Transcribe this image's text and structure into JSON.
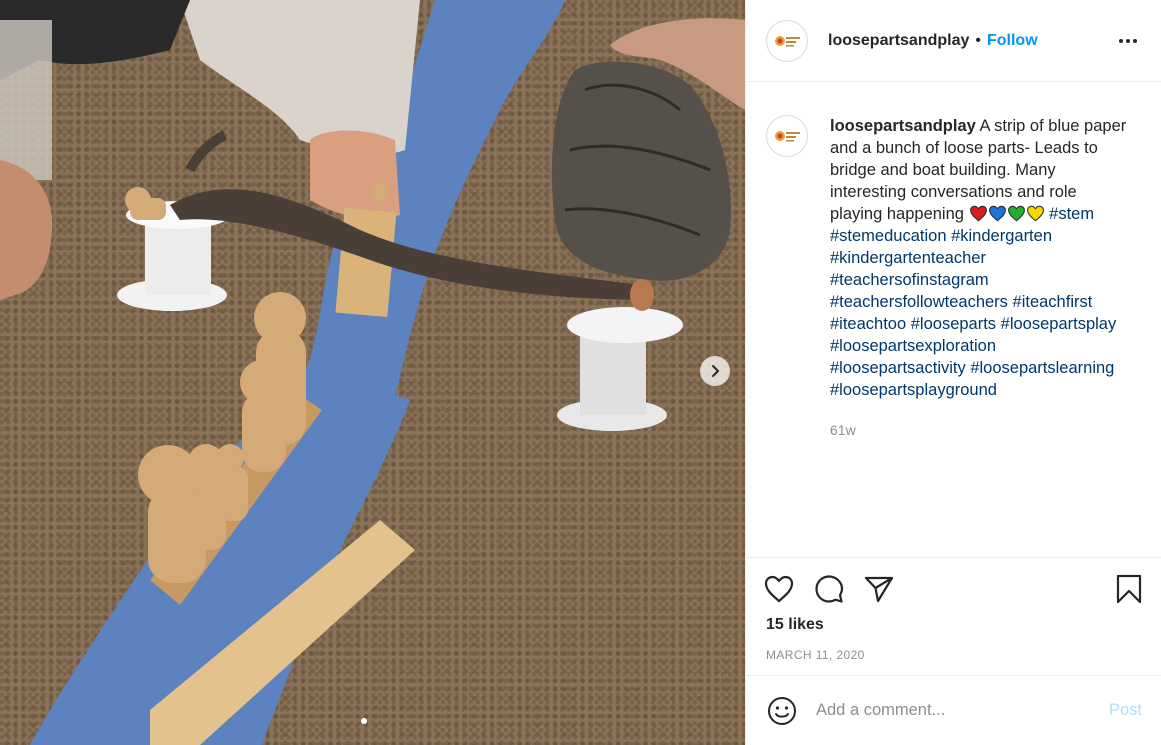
{
  "post": {
    "username": "loosepartsandplay",
    "follow_label": "Follow",
    "separator": "•",
    "avatar_icon": "loose-parts-logo",
    "avatar_text": "loose parts and play"
  },
  "caption": {
    "username": "loosepartsandplay",
    "text": "A strip of blue paper and a bunch of loose parts- Leads to bridge and boat building. Many interesting conversations and role playing happening",
    "hearts": [
      {
        "name": "red-heart-icon",
        "color": "#e0191f"
      },
      {
        "name": "blue-heart-icon",
        "color": "#1f74d9"
      },
      {
        "name": "green-heart-icon",
        "color": "#22b02a"
      },
      {
        "name": "yellow-heart-icon",
        "color": "#f5d800"
      }
    ],
    "hashtags": [
      "#stem",
      "#stemeducation",
      "#kindergarten",
      "#kindergartenteacher",
      "#teachersofinstagram",
      "#teachersfollowteachers",
      "#iteachfirst",
      "#iteachtoo",
      "#looseparts",
      "#loosepartsplay",
      "#loosepartsexploration",
      "#loosepartsactivity",
      "#loosepartslearning",
      "#loosepartsplayground"
    ],
    "posted_ago": "61w"
  },
  "actions": {
    "like_icon": "heart-outline-icon",
    "comment_icon": "comment-icon",
    "share_icon": "paper-plane-icon",
    "save_icon": "bookmark-icon"
  },
  "likes_label": "15 likes",
  "date_label": "MARCH 11, 2020",
  "comment": {
    "placeholder": "Add a comment...",
    "post_label": "Post",
    "emoji_icon": "smiley-icon"
  },
  "photo": {
    "carousel_current": 1,
    "next_icon": "chevron-right-icon"
  },
  "colors": {
    "accent": "#0095f6",
    "link": "#00376b",
    "muted": "#8e8e8e",
    "post_disabled": "#b2dffc"
  }
}
